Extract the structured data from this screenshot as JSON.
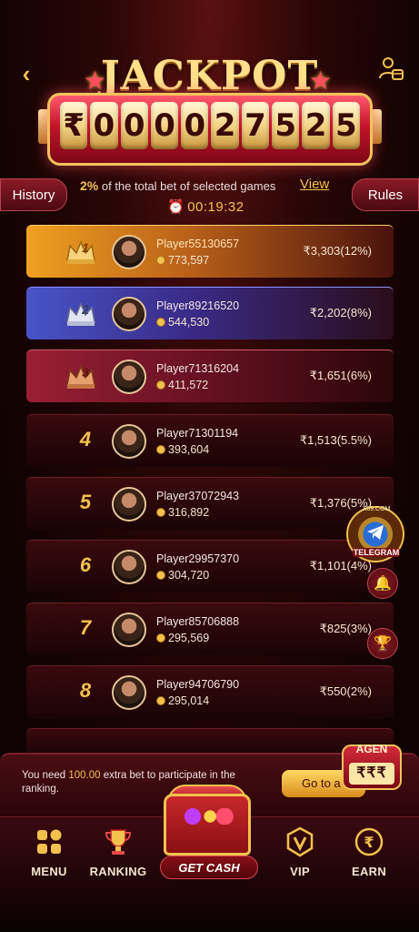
{
  "header": {
    "title": "JACKPOT",
    "jackpot_digits": [
      "₹",
      "0",
      "0",
      "0",
      "0",
      "2",
      "7",
      "5",
      "2",
      "5"
    ]
  },
  "info": {
    "history_label": "History",
    "rules_label": "Rules",
    "bet_percent": "2%",
    "bet_text": "of the total bet of selected games",
    "view_label": "View",
    "timer": "00:19:32"
  },
  "ranking": [
    {
      "rank": "1",
      "name": "Player55130657",
      "coins": "773,597",
      "prize": "₹3,303(12%)"
    },
    {
      "rank": "2",
      "name": "Player89216520",
      "coins": "544,530",
      "prize": "₹2,202(8%)"
    },
    {
      "rank": "3",
      "name": "Player71316204",
      "coins": "411,572",
      "prize": "₹1,651(6%)"
    },
    {
      "rank": "4",
      "name": "Player71301194",
      "coins": "393,604",
      "prize": "₹1,513(5.5%)"
    },
    {
      "rank": "5",
      "name": "Player37072943",
      "coins": "316,892",
      "prize": "₹1,376(5%)"
    },
    {
      "rank": "6",
      "name": "Player29957370",
      "coins": "304,720",
      "prize": "₹1,101(4%)"
    },
    {
      "rank": "7",
      "name": "Player85706888",
      "coins": "295,569",
      "prize": "₹825(3%)"
    },
    {
      "rank": "8",
      "name": "Player94706790",
      "coins": "295,014",
      "prize": "₹550(2%)"
    }
  ],
  "floating": {
    "telegram_top": "X69.COM",
    "telegram_label": "TELEGRAM"
  },
  "notice": {
    "prefix": "You need ",
    "amount": "100.00",
    "suffix": " extra bet to participate in the ranking.",
    "goto_label": "Go to a",
    "agent_label": "AGEN",
    "agent_rs": "₹₹₹"
  },
  "tabs": [
    {
      "label": "MENU",
      "icon": "menu-grid-icon"
    },
    {
      "label": "RANKING",
      "icon": "trophy-icon"
    },
    {
      "label": "GET CASH",
      "icon": "treasure-chest-icon"
    },
    {
      "label": "VIP",
      "icon": "vip-shield-icon"
    },
    {
      "label": "EARN",
      "icon": "rupee-coin-icon"
    }
  ],
  "colors": {
    "gold": "#f2c14e",
    "rank1": "#f0a020",
    "rank2": "#4854c8",
    "rank3": "#9a1f35",
    "background": "#2a0606"
  }
}
